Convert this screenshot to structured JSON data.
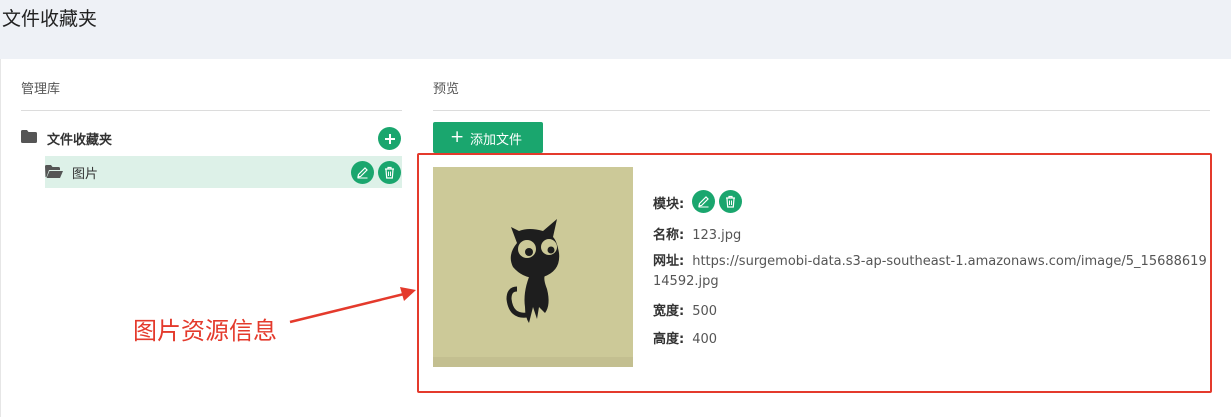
{
  "page": {
    "title": "文件收藏夹"
  },
  "library": {
    "header": "管理库",
    "root_folder": {
      "label": "文件收藏夹",
      "icon": "folder-icon"
    },
    "child_folder": {
      "label": "图片",
      "icon": "folder-open-icon"
    }
  },
  "preview": {
    "header": "预览",
    "add_file_label": "添加文件",
    "file": {
      "module_key": "模块:",
      "name_key": "名称:",
      "name_value": "123.jpg",
      "url_key": "网址:",
      "url_value": "https://surgemobi-data.s3-ap-southeast-1.amazonaws.com/image/5_1568861914592.jpg",
      "width_key": "宽度:",
      "width_value": "500",
      "height_key": "高度:",
      "height_value": "400"
    }
  },
  "annotation": {
    "text": "图片资源信息"
  },
  "colors": {
    "accent": "#1aa66e",
    "annotation": "#e43a2c",
    "selected_bg": "#ddf1e8",
    "thumb_bg": "#ccc998"
  }
}
